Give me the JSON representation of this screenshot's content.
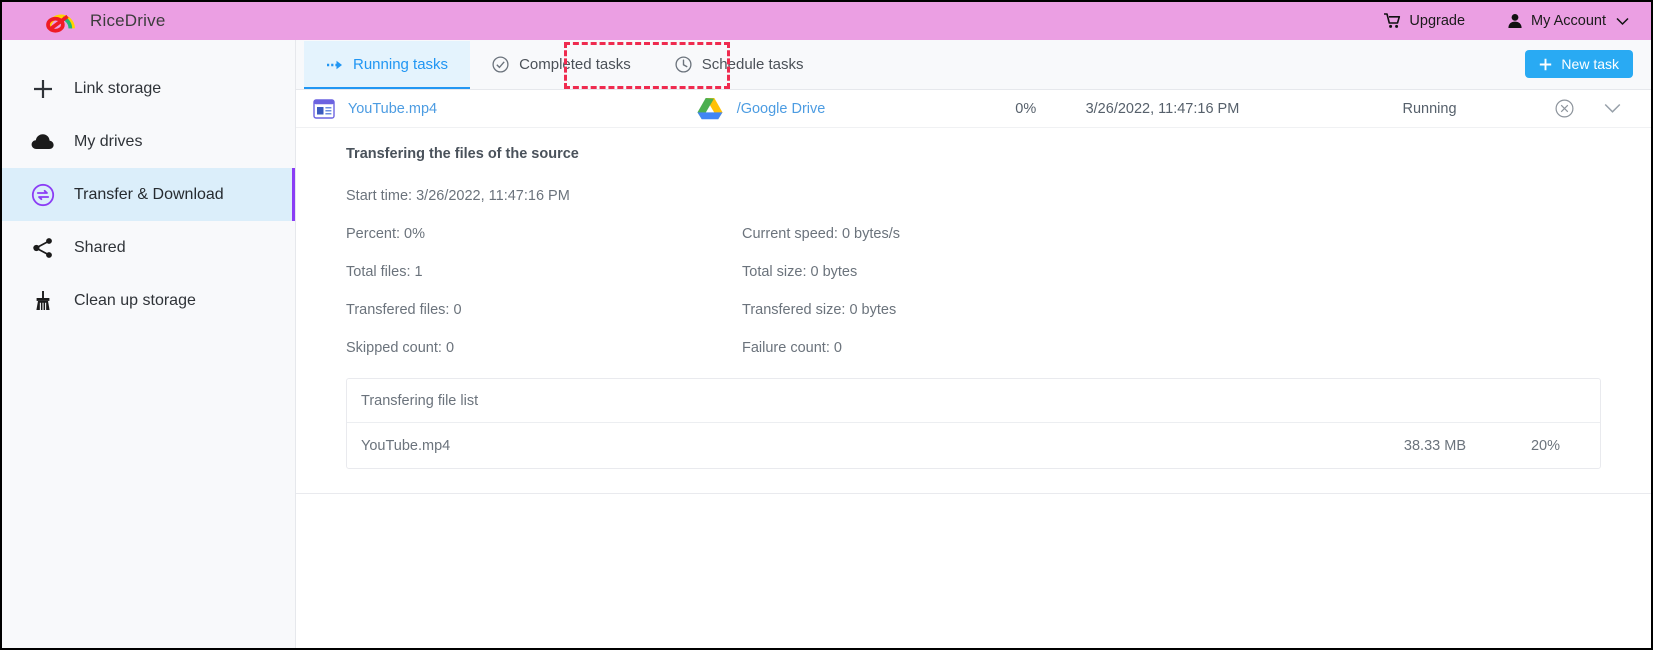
{
  "header": {
    "brand": "RiceDrive",
    "upgrade_label": "Upgrade",
    "account_label": "My Account"
  },
  "sidebar": {
    "items": [
      {
        "label": "Link storage",
        "icon": "plus-icon",
        "active": false
      },
      {
        "label": "My drives",
        "icon": "cloud-icon",
        "active": false
      },
      {
        "label": "Transfer & Download",
        "icon": "transfer-icon",
        "active": true
      },
      {
        "label": "Shared",
        "icon": "share-icon",
        "active": false
      },
      {
        "label": "Clean up storage",
        "icon": "broom-icon",
        "active": false
      }
    ],
    "accent_color": "#8b3df5",
    "active_bg": "#dbeefa"
  },
  "tabs": [
    {
      "label": "Running tasks",
      "icon": "arrow-right-icon",
      "active": true
    },
    {
      "label": "Completed tasks",
      "icon": "check-circle-icon",
      "active": false
    },
    {
      "label": "Schedule tasks",
      "icon": "clock-icon",
      "active": false
    }
  ],
  "toolbar": {
    "new_task_label": "New task",
    "new_task_icon": "plus-icon",
    "new_task_color": "#29aaf3"
  },
  "task": {
    "source_icon": "web-page-icon",
    "source_name": "YouTube.mp4",
    "dest_icon": "google-drive-icon",
    "dest_name": "/Google Drive",
    "percent": "0%",
    "time": "3/26/2022, 11:47:16 PM",
    "status": "Running",
    "cancel_icon": "cancel-circle-icon",
    "expand_icon": "chevron-down-icon"
  },
  "detail": {
    "title": "Transfering the files of the source",
    "start_time": "Start time: 3/26/2022, 11:47:16 PM",
    "percent": "Percent: 0%",
    "current_speed": "Current speed: 0 bytes/s",
    "total_files": "Total files: 1",
    "total_size": "Total size: 0 bytes",
    "transfered_files": "Transfered files: 0",
    "transfered_size": "Transfered size: 0 bytes",
    "skipped_count": "Skipped count: 0",
    "failure_count": "Failure count: 0"
  },
  "filelist": {
    "header": "Transfering file list",
    "rows": [
      {
        "name": "YouTube.mp4",
        "size": "38.33 MB",
        "percent": "20%"
      }
    ]
  }
}
